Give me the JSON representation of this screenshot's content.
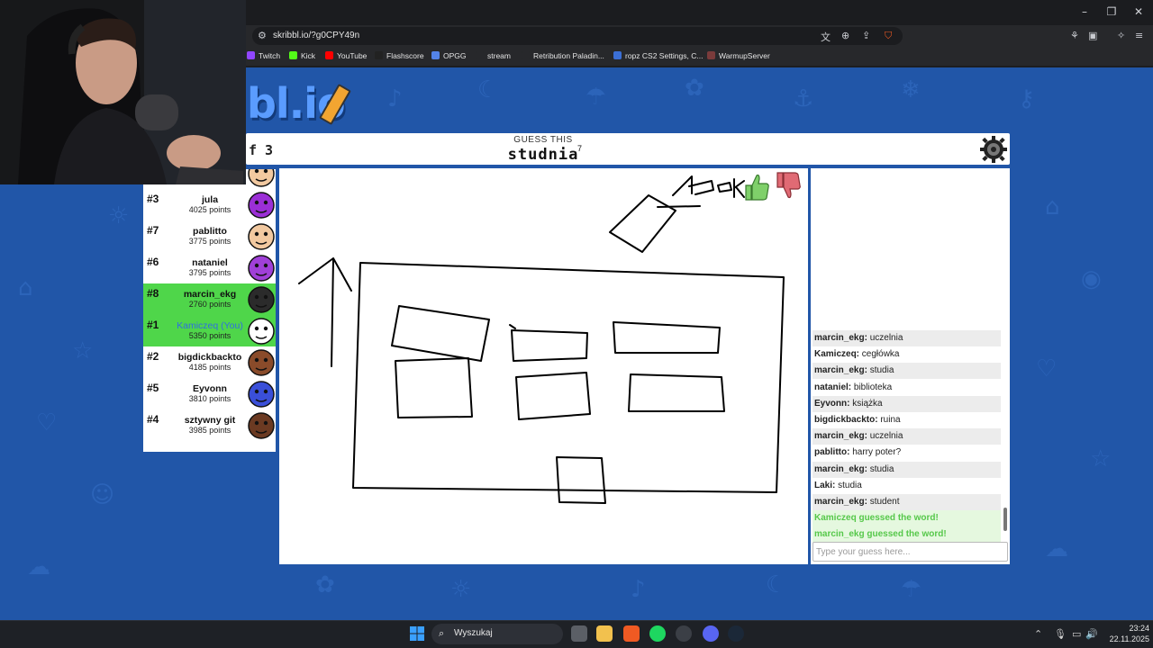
{
  "browser": {
    "url": "skribbl.io/?g0CPY49n",
    "bookmarks": [
      {
        "label": "Twitch",
        "color": "#9146ff"
      },
      {
        "label": "Kick",
        "color": "#53fc18"
      },
      {
        "label": "YouTube",
        "color": "#ff0000"
      },
      {
        "label": "Flashscore",
        "color": "#222222"
      },
      {
        "label": "OPGG",
        "color": "#5383e8"
      },
      {
        "label": "stream",
        "color": "#27282b"
      },
      {
        "label": "Retribution Paladin...",
        "color": "#27282b"
      },
      {
        "label": "ropz CS2 Settings, C...",
        "color": "#3b6fd6"
      },
      {
        "label": "WarmupServer",
        "color": "#7a3b3b"
      }
    ]
  },
  "game": {
    "logo_text": "bl.io",
    "round_fragment": "f 3",
    "guess_title": "GUESS THIS",
    "word": "studnia",
    "word_length": "7"
  },
  "players": [
    {
      "rank": "",
      "name": "",
      "points": "4185 points",
      "guessed": false,
      "you": false,
      "avatar_color": "#f2c9a0",
      "partial": true
    },
    {
      "rank": "#3",
      "name": "jula",
      "points": "4025 points",
      "guessed": false,
      "you": false,
      "avatar_color": "#9b2fd6"
    },
    {
      "rank": "#7",
      "name": "pablitto",
      "points": "3775 points",
      "guessed": false,
      "you": false,
      "avatar_color": "#f2c9a0"
    },
    {
      "rank": "#6",
      "name": "nataniel",
      "points": "3795 points",
      "guessed": false,
      "you": false,
      "avatar_color": "#a040d8"
    },
    {
      "rank": "#8",
      "name": "marcin_ekg",
      "points": "2760 points",
      "guessed": true,
      "you": false,
      "avatar_color": "#2b2b2b"
    },
    {
      "rank": "#1",
      "name": "Kamiczeq (You)",
      "points": "5350 points",
      "guessed": true,
      "you": true,
      "avatar_color": "#ffffff"
    },
    {
      "rank": "#2",
      "name": "bigdickbackto",
      "points": "4185 points",
      "guessed": false,
      "you": false,
      "avatar_color": "#8a4b2a"
    },
    {
      "rank": "#5",
      "name": "Eyvonn",
      "points": "3810 points",
      "guessed": false,
      "you": false,
      "avatar_color": "#3a4fd8"
    },
    {
      "rank": "#4",
      "name": "sztywny git",
      "points": "3985 points",
      "guessed": false,
      "you": false,
      "avatar_color": "#6b3a22"
    }
  ],
  "chat": {
    "messages": [
      {
        "user": "marcin_ekg:",
        "text": " uczelnia",
        "system": false
      },
      {
        "user": "Kamiczeq:",
        "text": " cegłówka",
        "system": false
      },
      {
        "user": "marcin_ekg:",
        "text": " studia",
        "system": false
      },
      {
        "user": "nataniel:",
        "text": " biblioteka",
        "system": false
      },
      {
        "user": "Eyvonn:",
        "text": " książka",
        "system": false
      },
      {
        "user": "bigdickbackto:",
        "text": " ruina",
        "system": false
      },
      {
        "user": "marcin_ekg:",
        "text": " uczelnia",
        "system": false
      },
      {
        "user": "pablitto:",
        "text": " harry poter?",
        "system": false
      },
      {
        "user": "marcin_ekg:",
        "text": " studia",
        "system": false
      },
      {
        "user": "Laki:",
        "text": " studia",
        "system": false
      },
      {
        "user": "marcin_ekg:",
        "text": " student",
        "system": false
      },
      {
        "user": "",
        "text": "Kamiczeq guessed the word!",
        "system": true
      },
      {
        "user": "",
        "text": "marcin_ekg guessed the word!",
        "system": true
      }
    ],
    "input_placeholder": "Type your guess here..."
  },
  "taskbar": {
    "search_label": "Wyszukaj",
    "time": "23:24",
    "date": "22.11.2025"
  },
  "colors": {
    "game_background": "#2156a8",
    "guessed_green": "#4fd64a",
    "you_blue": "#2f6fe0",
    "system_message_green": "#56c84a"
  }
}
